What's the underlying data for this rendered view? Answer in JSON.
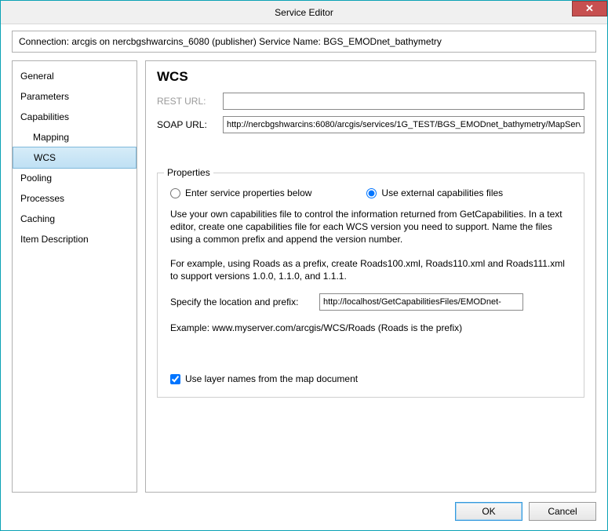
{
  "window": {
    "title": "Service Editor",
    "close_label": "✕"
  },
  "connection": {
    "text": "Connection: arcgis on nercbgshwarcins_6080 (publisher)   Service Name: BGS_EMODnet_bathymetry"
  },
  "nav": {
    "items": [
      {
        "label": "General",
        "child": false,
        "selected": false
      },
      {
        "label": "Parameters",
        "child": false,
        "selected": false
      },
      {
        "label": "Capabilities",
        "child": false,
        "selected": false
      },
      {
        "label": "Mapping",
        "child": true,
        "selected": false
      },
      {
        "label": "WCS",
        "child": true,
        "selected": true
      },
      {
        "label": "Pooling",
        "child": false,
        "selected": false
      },
      {
        "label": "Processes",
        "child": false,
        "selected": false
      },
      {
        "label": "Caching",
        "child": false,
        "selected": false
      },
      {
        "label": "Item Description",
        "child": false,
        "selected": false
      }
    ]
  },
  "content": {
    "title": "WCS",
    "rest_label": "REST URL:",
    "rest_value": "",
    "soap_label": "SOAP URL:",
    "soap_value": "http://nercbgshwarcins:6080/arcgis/services/1G_TEST/BGS_EMODnet_bathymetry/MapServ"
  },
  "props": {
    "legend": "Properties",
    "radio_enter": "Enter service properties below",
    "radio_external": "Use external capabilities files",
    "para1": "Use your own capabilities file to control the information returned from GetCapabilities. In a text editor, create one capabilities file for each WCS version you need to support. Name the files using a common prefix and append the version number.",
    "para2": "For example, using Roads as a prefix, create Roads100.xml, Roads110.xml and Roads111.xml to support versions 1.0.0, 1.1.0, and 1.1.1.",
    "prefix_label": "Specify the location and prefix:",
    "prefix_value": "http://localhost/GetCapabilitiesFiles/EMODnet-",
    "example": "Example: www.myserver.com/arcgis/WCS/Roads (Roads is the prefix)",
    "check_label": "Use layer names from the map document"
  },
  "footer": {
    "ok": "OK",
    "cancel": "Cancel"
  }
}
